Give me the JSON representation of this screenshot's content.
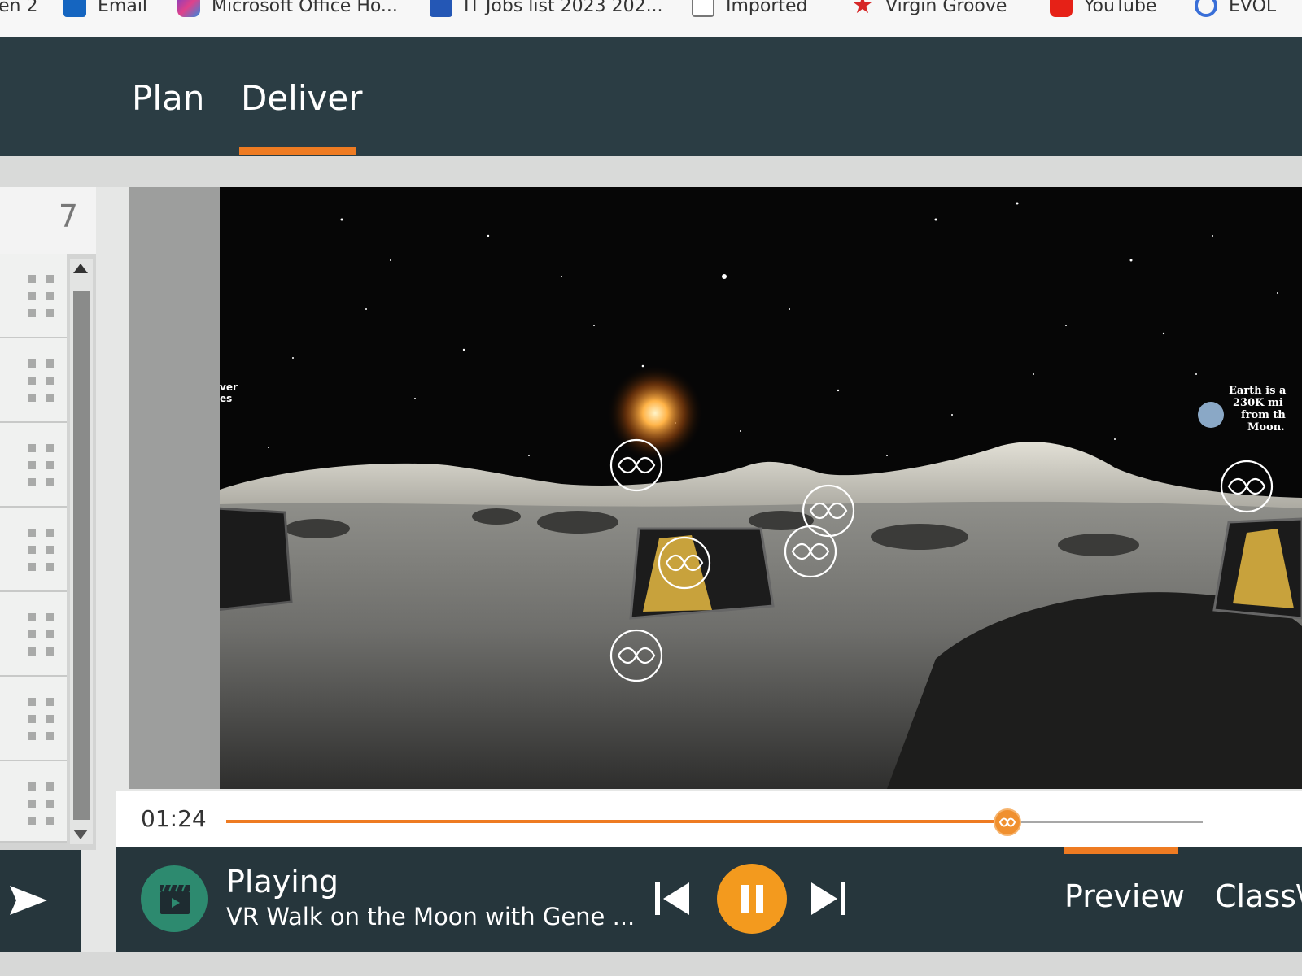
{
  "bookmarks": [
    {
      "label": "en 2",
      "icon": "none"
    },
    {
      "label": "Email",
      "icon": "outlook-icon"
    },
    {
      "label": "Microsoft Office Ho...",
      "icon": "office-icon"
    },
    {
      "label": "IT Jobs list 2023 202...",
      "icon": "word-icon"
    },
    {
      "label": "Imported",
      "icon": "folder-icon"
    },
    {
      "label": "Virgin Groove",
      "icon": "star-icon"
    },
    {
      "label": "YouTube",
      "icon": "youtube-icon"
    },
    {
      "label": "EVOL",
      "icon": "evol-icon"
    }
  ],
  "nav": {
    "tabs": [
      "Plan",
      "Deliver"
    ],
    "active_tab": "Deliver"
  },
  "slides": {
    "current_number": "7",
    "row_count": 7
  },
  "scene": {
    "left_text": "ver\nes",
    "earth_note": "Earth is a\n230K mi\nfrom th\nMoon."
  },
  "player": {
    "time": "01:24",
    "progress": 0.8,
    "status": "Playing",
    "title": "VR Walk on the Moon with Gene ..."
  },
  "bottom_tabs": {
    "preview": "Preview",
    "classview": "Class\\"
  },
  "colors": {
    "header": "#2b3d44",
    "accent": "#ee7b22",
    "pause_button": "#f39a1e",
    "media_icon": "#2d8a6f"
  }
}
